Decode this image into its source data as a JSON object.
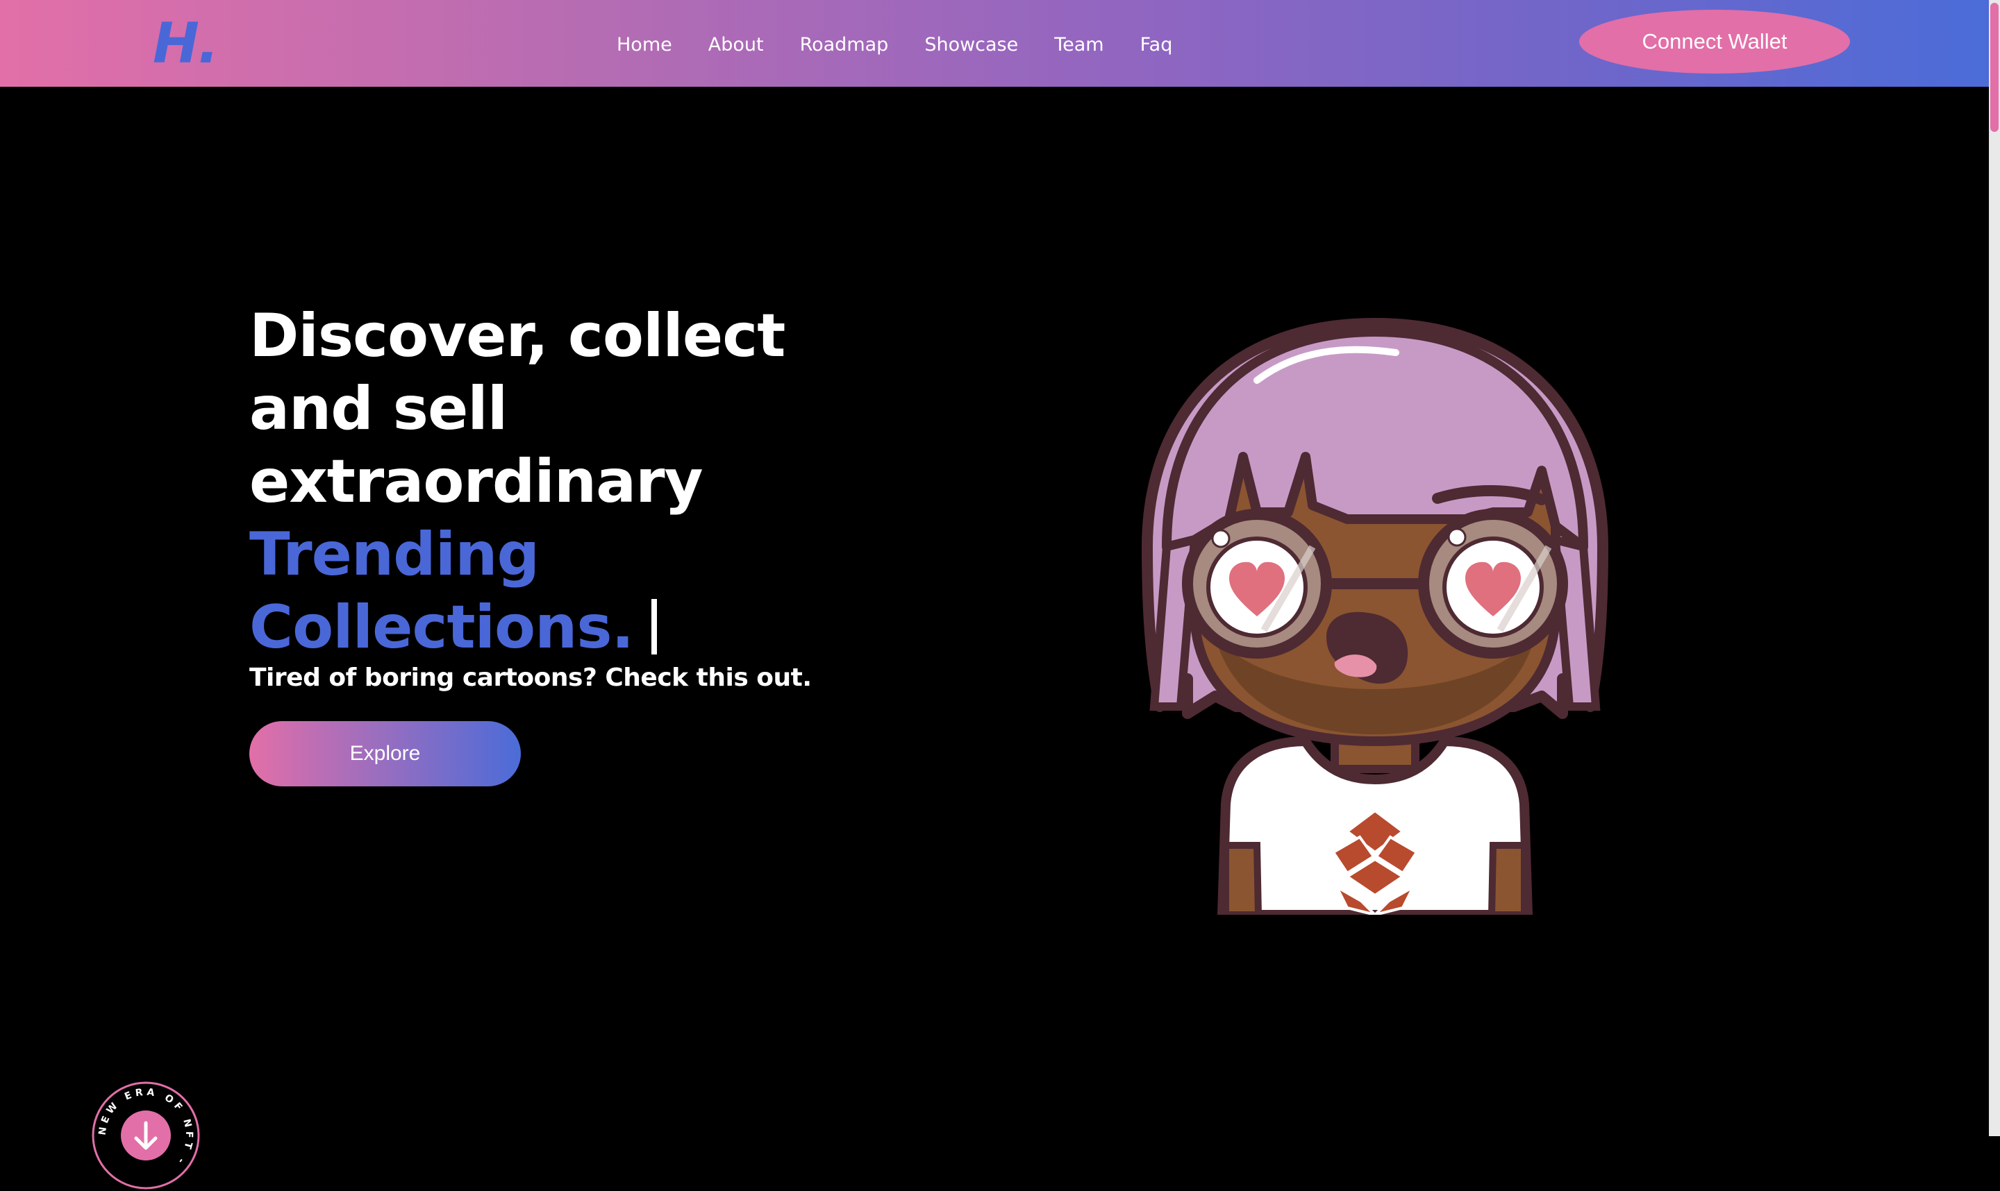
{
  "brand": {
    "logo_text": "H.",
    "accent_color": "#4a67d8",
    "pink_color": "#e26fa8"
  },
  "nav": {
    "links": [
      "Home",
      "About",
      "Roadmap",
      "Showcase",
      "Team",
      "Faq"
    ],
    "connect_label": "Connect Wallet"
  },
  "hero": {
    "title_lines": [
      "Discover, collect",
      "and sell",
      "extraordinary"
    ],
    "accent_lines": [
      "Trending",
      "Collections."
    ],
    "cursor": "|",
    "subtitle": "Tired of boring cartoons? Check this out.",
    "explore_label": "Explore"
  },
  "badge": {
    "text": "NEW ERA OF NFT -",
    "icon": "arrow-icon"
  },
  "illustration": {
    "subject": "cartoon-girl-nft-icon"
  }
}
